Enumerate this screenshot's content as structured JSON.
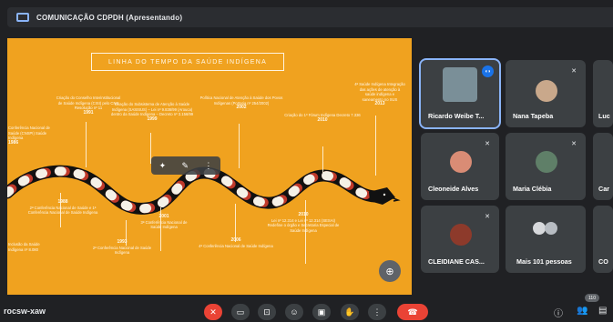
{
  "header": {
    "title": "COMUNICAÇÃO CDPDH (Apresentando)"
  },
  "slide": {
    "title": "LINHA DO TEMPO DA SAÚDE INDÍGENA",
    "top_events": [
      {
        "text": "Criação do Conselho Interinstitucional de Saúde Indígena (CISI) pelo CNS Resolução nº 11",
        "year": "1991"
      },
      {
        "text": "Criação do Subsistema de Atenção à Saúde Indígena (SASISUS) – Lei nº 9.836/99 (Arouca) dentro da Saúde Indígena – Decreto nº 3.156/99",
        "year": "1999"
      },
      {
        "text": "Política Nacional de Atenção à Saúde dos Povos Indígenas (Portaria nº 254/2002)",
        "year": "2002"
      },
      {
        "text": "Criação do 1º Fórum Indígena Decreto 7.336",
        "year": "2010"
      },
      {
        "text": "4ª Saúde Indígena Integração das ações de atenção à saúde indígena e saneamento no SUS",
        "year": "2013"
      }
    ],
    "left_events": [
      {
        "text": "Conferência Nacional de Saúde (CNSPI) Saúde Indígena",
        "year": "1986"
      }
    ],
    "bottom_events": [
      {
        "text": "2ª Conferência Nacional de Saúde e 1ª Conferência Nacional de Saúde Indígena",
        "year": "1988"
      },
      {
        "text": "3ª Conferência Nacional de Saúde Indígena",
        "year": "2001"
      },
      {
        "text": "2ª Conferência Nacional de Saúde Indígena",
        "year": "1993"
      },
      {
        "text": "4ª Conferência Nacional de Saúde Indígena",
        "year": "2006"
      },
      {
        "text": "Lei nº 12.314 e Lei nº 12.314 (SESAI) Redefine o órgão e Secretaria Especial de Saúde Indígena",
        "year": "2010"
      }
    ],
    "left_bottom_event": {
      "text": "Inclusão da Saúde Indígena nº 8.080",
      "year": ""
    }
  },
  "participants": [
    {
      "name": "Ricardo Weibe T...",
      "muted": false,
      "speaking": true
    },
    {
      "name": "Nana Tapeba",
      "muted": true
    },
    {
      "name": "Luc",
      "muted": false
    },
    {
      "name": "Cleoneide Alves",
      "muted": true
    },
    {
      "name": "Maria Clébia",
      "muted": true
    },
    {
      "name": "Car",
      "muted": false
    },
    {
      "name": "CLEIDIANE CAS...",
      "muted": true
    },
    {
      "name": "Mais 101 pessoas",
      "muted": false
    },
    {
      "name": "CO",
      "muted": false
    }
  ],
  "bottom": {
    "meeting_code": "rocsw-xaw",
    "participant_count": "110"
  },
  "icons": [
    "present-icon",
    "mic-off-icon",
    "camera-icon",
    "captions-icon",
    "emoji-icon",
    "present-screen-icon",
    "raise-hand-icon",
    "more-icon",
    "end-call-icon",
    "info-icon",
    "people-icon",
    "chat-icon",
    "zoom-icon"
  ],
  "colors": {
    "slide_bg": "#f0a21f",
    "accent_blue": "#8ab4f8",
    "danger": "#ea4335"
  }
}
